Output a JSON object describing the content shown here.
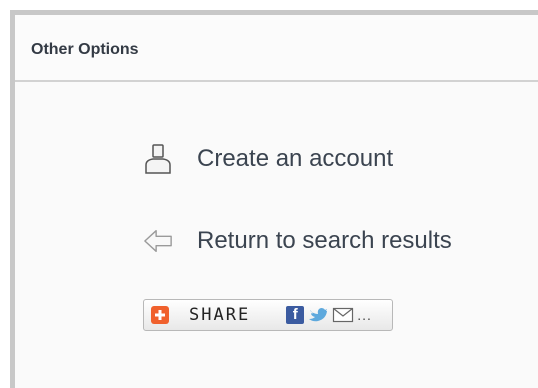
{
  "panel": {
    "title": "Other Options"
  },
  "options": {
    "create_account": "Create an account",
    "return_results": "Return to search results"
  },
  "share": {
    "label": "SHARE",
    "facebook_glyph": "f",
    "more_glyph": "..."
  },
  "colors": {
    "share_accent": "#f0612d",
    "facebook": "#3b5ba0",
    "twitter": "#5ea9dd"
  }
}
